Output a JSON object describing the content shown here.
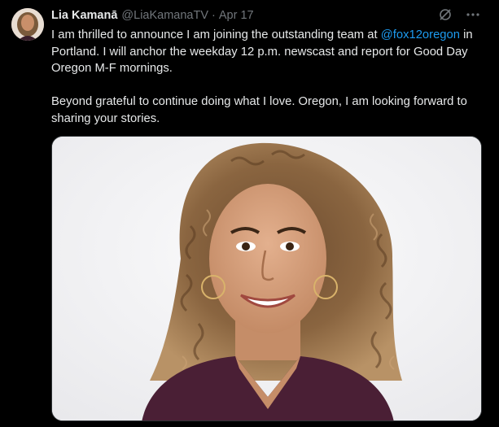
{
  "author": {
    "display_name": "Lia Kamanā",
    "handle": "@LiaKamanaTV",
    "separator": "·",
    "date": "Apr 17"
  },
  "actions": {
    "grok_icon": "slash-circle-icon",
    "more_icon": "more-horizontal-icon",
    "more_label": "···"
  },
  "tweet": {
    "line1_before": "I am thrilled to announce I am joining the outstanding team at ",
    "mention": "@fox12oregon",
    "line1_after": " in Portland. I will anchor the weekday 12 p.m. newscast and report for Good Day Oregon M-F mornings.",
    "paragraph2": "Beyond grateful to continue doing what I love. Oregon, I am looking forward to sharing your stories."
  },
  "media": {
    "type": "photo",
    "description_icon": "portrait-photo"
  },
  "colors": {
    "background": "#000000",
    "text": "#e7e9ea",
    "secondary": "#71767b",
    "link": "#1d9bf0",
    "border": "#2f3336"
  }
}
